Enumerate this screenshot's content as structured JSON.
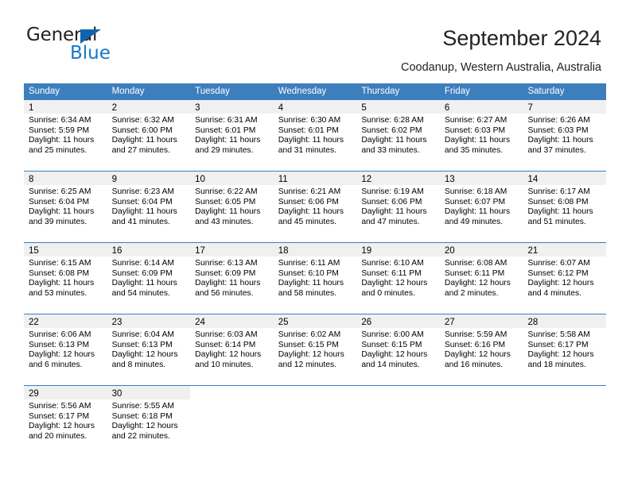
{
  "brand": {
    "name_top": "General",
    "name_bottom": "Blue"
  },
  "header": {
    "title": "September 2024",
    "location": "Coodanup, Western Australia, Australia"
  },
  "colors": {
    "header_blue": "#3d7ebd",
    "logo_blue": "#1578c8",
    "daynum_bg": "#f0f0f0"
  },
  "weekdays": [
    "Sunday",
    "Monday",
    "Tuesday",
    "Wednesday",
    "Thursday",
    "Friday",
    "Saturday"
  ],
  "labels": {
    "sunrise_prefix": "Sunrise:",
    "sunset_prefix": "Sunset:",
    "daylight_prefix": "Daylight:"
  },
  "weeks": [
    [
      {
        "day": "1",
        "sunrise": "Sunrise: 6:34 AM",
        "sunset": "Sunset: 5:59 PM",
        "daylight_1": "Daylight: 11 hours",
        "daylight_2": "and 25 minutes."
      },
      {
        "day": "2",
        "sunrise": "Sunrise: 6:32 AM",
        "sunset": "Sunset: 6:00 PM",
        "daylight_1": "Daylight: 11 hours",
        "daylight_2": "and 27 minutes."
      },
      {
        "day": "3",
        "sunrise": "Sunrise: 6:31 AM",
        "sunset": "Sunset: 6:01 PM",
        "daylight_1": "Daylight: 11 hours",
        "daylight_2": "and 29 minutes."
      },
      {
        "day": "4",
        "sunrise": "Sunrise: 6:30 AM",
        "sunset": "Sunset: 6:01 PM",
        "daylight_1": "Daylight: 11 hours",
        "daylight_2": "and 31 minutes."
      },
      {
        "day": "5",
        "sunrise": "Sunrise: 6:28 AM",
        "sunset": "Sunset: 6:02 PM",
        "daylight_1": "Daylight: 11 hours",
        "daylight_2": "and 33 minutes."
      },
      {
        "day": "6",
        "sunrise": "Sunrise: 6:27 AM",
        "sunset": "Sunset: 6:03 PM",
        "daylight_1": "Daylight: 11 hours",
        "daylight_2": "and 35 minutes."
      },
      {
        "day": "7",
        "sunrise": "Sunrise: 6:26 AM",
        "sunset": "Sunset: 6:03 PM",
        "daylight_1": "Daylight: 11 hours",
        "daylight_2": "and 37 minutes."
      }
    ],
    [
      {
        "day": "8",
        "sunrise": "Sunrise: 6:25 AM",
        "sunset": "Sunset: 6:04 PM",
        "daylight_1": "Daylight: 11 hours",
        "daylight_2": "and 39 minutes."
      },
      {
        "day": "9",
        "sunrise": "Sunrise: 6:23 AM",
        "sunset": "Sunset: 6:04 PM",
        "daylight_1": "Daylight: 11 hours",
        "daylight_2": "and 41 minutes."
      },
      {
        "day": "10",
        "sunrise": "Sunrise: 6:22 AM",
        "sunset": "Sunset: 6:05 PM",
        "daylight_1": "Daylight: 11 hours",
        "daylight_2": "and 43 minutes."
      },
      {
        "day": "11",
        "sunrise": "Sunrise: 6:21 AM",
        "sunset": "Sunset: 6:06 PM",
        "daylight_1": "Daylight: 11 hours",
        "daylight_2": "and 45 minutes."
      },
      {
        "day": "12",
        "sunrise": "Sunrise: 6:19 AM",
        "sunset": "Sunset: 6:06 PM",
        "daylight_1": "Daylight: 11 hours",
        "daylight_2": "and 47 minutes."
      },
      {
        "day": "13",
        "sunrise": "Sunrise: 6:18 AM",
        "sunset": "Sunset: 6:07 PM",
        "daylight_1": "Daylight: 11 hours",
        "daylight_2": "and 49 minutes."
      },
      {
        "day": "14",
        "sunrise": "Sunrise: 6:17 AM",
        "sunset": "Sunset: 6:08 PM",
        "daylight_1": "Daylight: 11 hours",
        "daylight_2": "and 51 minutes."
      }
    ],
    [
      {
        "day": "15",
        "sunrise": "Sunrise: 6:15 AM",
        "sunset": "Sunset: 6:08 PM",
        "daylight_1": "Daylight: 11 hours",
        "daylight_2": "and 53 minutes."
      },
      {
        "day": "16",
        "sunrise": "Sunrise: 6:14 AM",
        "sunset": "Sunset: 6:09 PM",
        "daylight_1": "Daylight: 11 hours",
        "daylight_2": "and 54 minutes."
      },
      {
        "day": "17",
        "sunrise": "Sunrise: 6:13 AM",
        "sunset": "Sunset: 6:09 PM",
        "daylight_1": "Daylight: 11 hours",
        "daylight_2": "and 56 minutes."
      },
      {
        "day": "18",
        "sunrise": "Sunrise: 6:11 AM",
        "sunset": "Sunset: 6:10 PM",
        "daylight_1": "Daylight: 11 hours",
        "daylight_2": "and 58 minutes."
      },
      {
        "day": "19",
        "sunrise": "Sunrise: 6:10 AM",
        "sunset": "Sunset: 6:11 PM",
        "daylight_1": "Daylight: 12 hours",
        "daylight_2": "and 0 minutes."
      },
      {
        "day": "20",
        "sunrise": "Sunrise: 6:08 AM",
        "sunset": "Sunset: 6:11 PM",
        "daylight_1": "Daylight: 12 hours",
        "daylight_2": "and 2 minutes."
      },
      {
        "day": "21",
        "sunrise": "Sunrise: 6:07 AM",
        "sunset": "Sunset: 6:12 PM",
        "daylight_1": "Daylight: 12 hours",
        "daylight_2": "and 4 minutes."
      }
    ],
    [
      {
        "day": "22",
        "sunrise": "Sunrise: 6:06 AM",
        "sunset": "Sunset: 6:13 PM",
        "daylight_1": "Daylight: 12 hours",
        "daylight_2": "and 6 minutes."
      },
      {
        "day": "23",
        "sunrise": "Sunrise: 6:04 AM",
        "sunset": "Sunset: 6:13 PM",
        "daylight_1": "Daylight: 12 hours",
        "daylight_2": "and 8 minutes."
      },
      {
        "day": "24",
        "sunrise": "Sunrise: 6:03 AM",
        "sunset": "Sunset: 6:14 PM",
        "daylight_1": "Daylight: 12 hours",
        "daylight_2": "and 10 minutes."
      },
      {
        "day": "25",
        "sunrise": "Sunrise: 6:02 AM",
        "sunset": "Sunset: 6:15 PM",
        "daylight_1": "Daylight: 12 hours",
        "daylight_2": "and 12 minutes."
      },
      {
        "day": "26",
        "sunrise": "Sunrise: 6:00 AM",
        "sunset": "Sunset: 6:15 PM",
        "daylight_1": "Daylight: 12 hours",
        "daylight_2": "and 14 minutes."
      },
      {
        "day": "27",
        "sunrise": "Sunrise: 5:59 AM",
        "sunset": "Sunset: 6:16 PM",
        "daylight_1": "Daylight: 12 hours",
        "daylight_2": "and 16 minutes."
      },
      {
        "day": "28",
        "sunrise": "Sunrise: 5:58 AM",
        "sunset": "Sunset: 6:17 PM",
        "daylight_1": "Daylight: 12 hours",
        "daylight_2": "and 18 minutes."
      }
    ],
    [
      {
        "day": "29",
        "sunrise": "Sunrise: 5:56 AM",
        "sunset": "Sunset: 6:17 PM",
        "daylight_1": "Daylight: 12 hours",
        "daylight_2": "and 20 minutes."
      },
      {
        "day": "30",
        "sunrise": "Sunrise: 5:55 AM",
        "sunset": "Sunset: 6:18 PM",
        "daylight_1": "Daylight: 12 hours",
        "daylight_2": "and 22 minutes."
      },
      {
        "day": "",
        "sunrise": "",
        "sunset": "",
        "daylight_1": "",
        "daylight_2": ""
      },
      {
        "day": "",
        "sunrise": "",
        "sunset": "",
        "daylight_1": "",
        "daylight_2": ""
      },
      {
        "day": "",
        "sunrise": "",
        "sunset": "",
        "daylight_1": "",
        "daylight_2": ""
      },
      {
        "day": "",
        "sunrise": "",
        "sunset": "",
        "daylight_1": "",
        "daylight_2": ""
      },
      {
        "day": "",
        "sunrise": "",
        "sunset": "",
        "daylight_1": "",
        "daylight_2": ""
      }
    ]
  ]
}
